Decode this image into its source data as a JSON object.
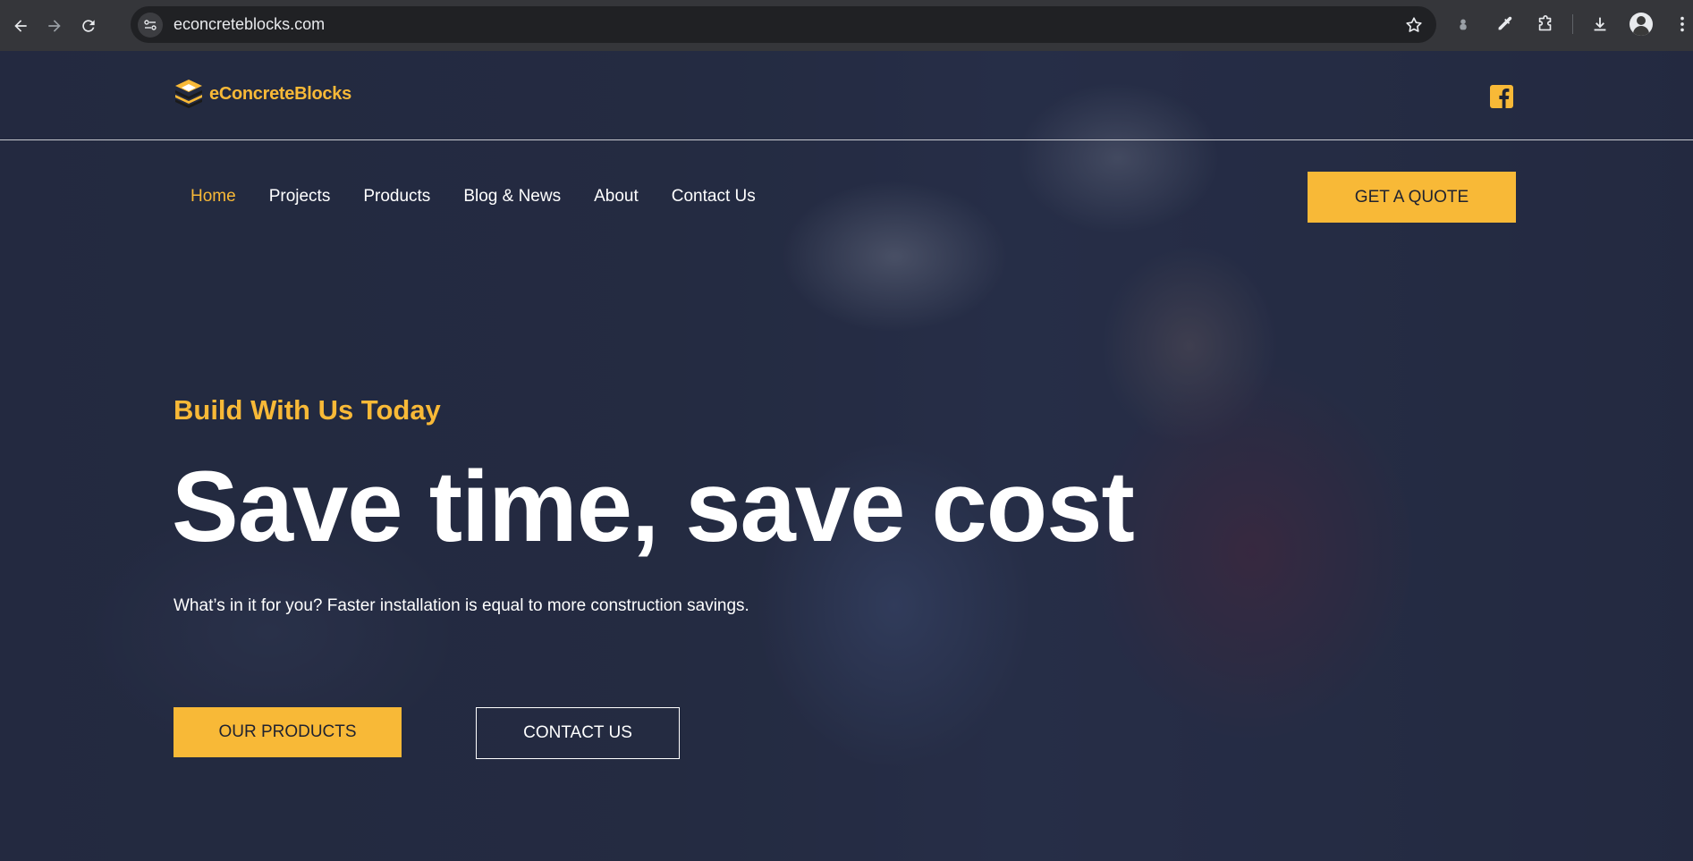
{
  "browser": {
    "url": "econcreteblocks.com",
    "icons": [
      "back-icon",
      "forward-icon",
      "reload-icon",
      "site-info-icon",
      "bookmark-star-icon",
      "extension-icon",
      "eyedropper-icon",
      "puzzle-icon",
      "download-icon",
      "profile-avatar"
    ]
  },
  "site": {
    "logo_text": "eConcreteBlocks",
    "brand_color": "#f8b937",
    "social": "facebook-icon"
  },
  "nav": {
    "items": [
      {
        "label": "Home",
        "active": true
      },
      {
        "label": "Projects"
      },
      {
        "label": "Products"
      },
      {
        "label": "Blog & News"
      },
      {
        "label": "About"
      },
      {
        "label": "Contact Us"
      }
    ],
    "cta": "GET A QUOTE"
  },
  "hero": {
    "tagline": "Build With Us Today",
    "headline": "Save time, save cost",
    "subtext": "What’s in it for you? Faster installation is equal to more construction savings.",
    "primary_button": "OUR PRODUCTS",
    "secondary_button": "CONTACT US"
  }
}
